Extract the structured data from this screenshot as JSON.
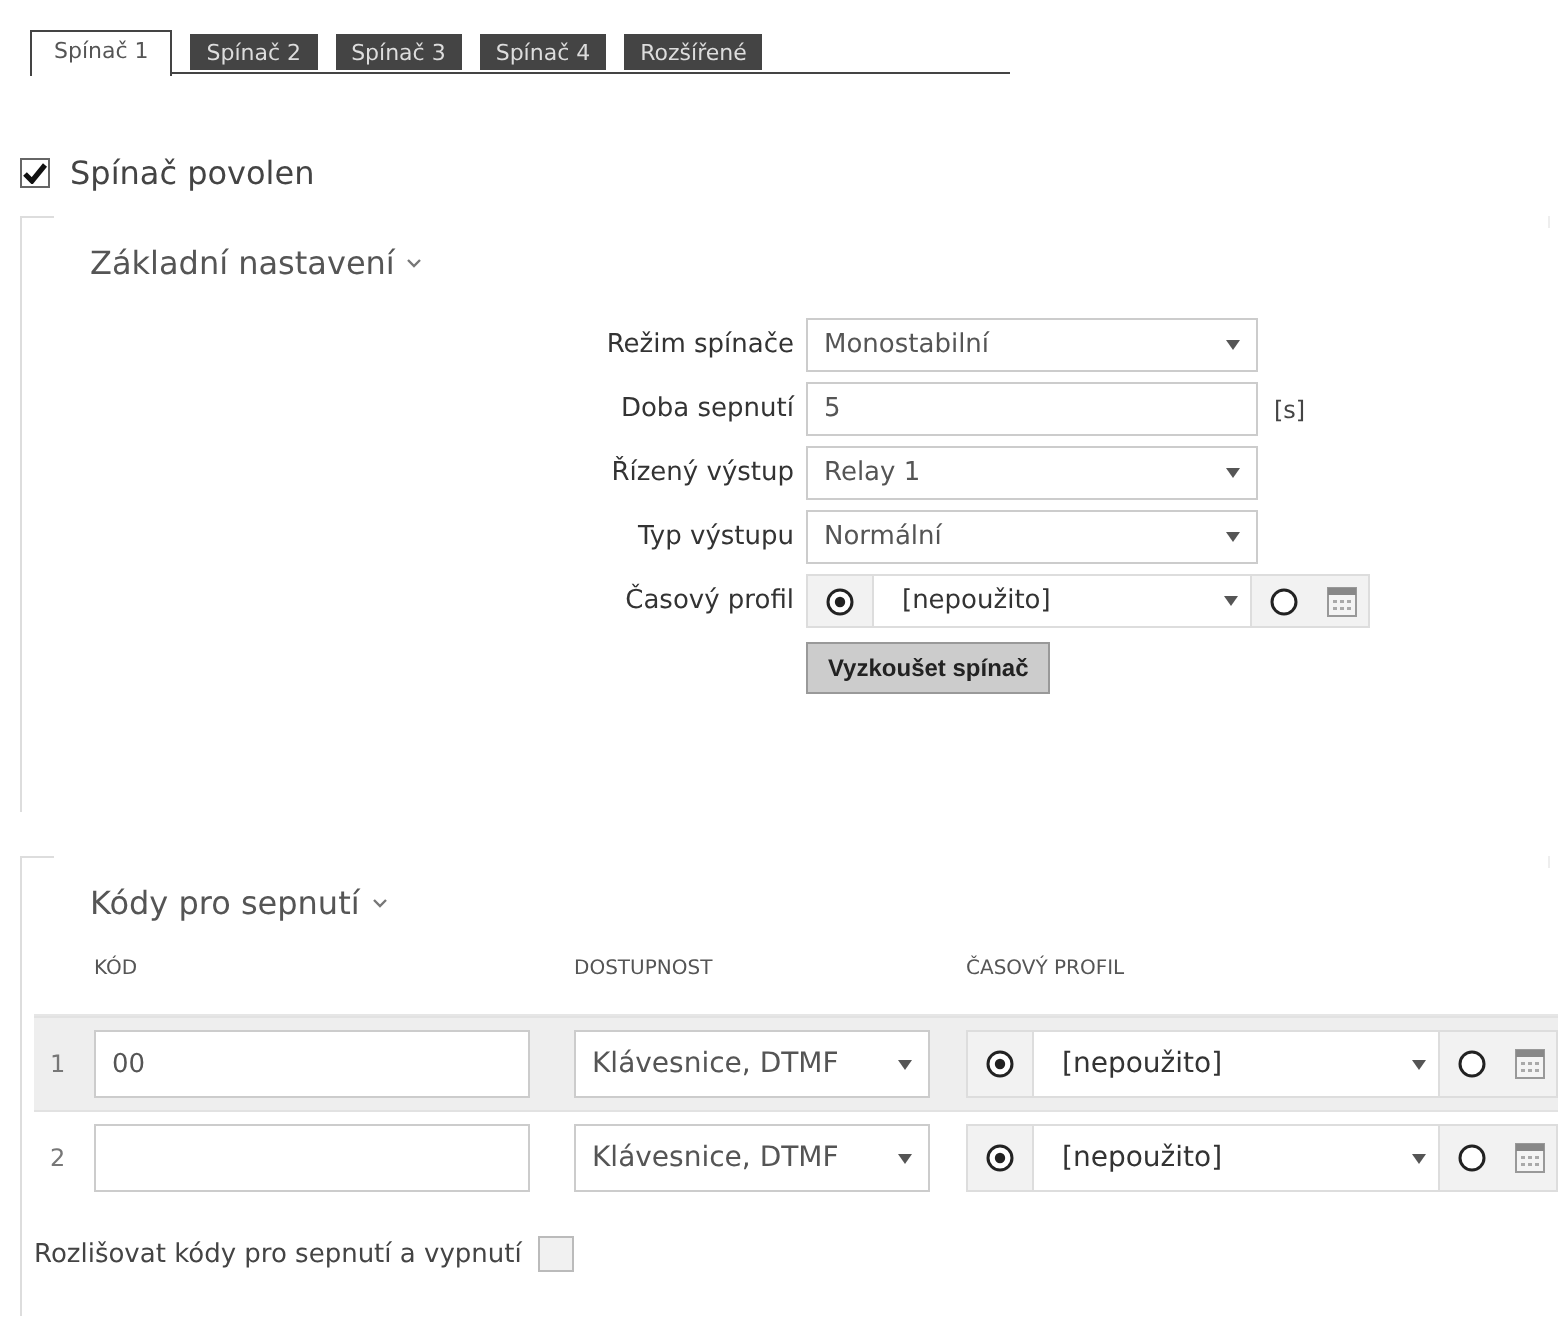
{
  "tabs": [
    {
      "label": "Spínač 1",
      "selected": true
    },
    {
      "label": "Spínač 2",
      "selected": false
    },
    {
      "label": "Spínač 3",
      "selected": false
    },
    {
      "label": "Spínač 4",
      "selected": false
    },
    {
      "label": "Rozšířené",
      "selected": false
    }
  ],
  "enabled": {
    "label": "Spínač povolen",
    "checked": true
  },
  "basic": {
    "title": "Základní nastavení",
    "expanded": true,
    "fields": [
      {
        "kind": "select",
        "label": "Režim spínače",
        "value": "Monostabilní"
      },
      {
        "kind": "text",
        "label": "Doba sepnutí",
        "value": "5",
        "unit": "[s]"
      },
      {
        "kind": "select",
        "label": "Řízený výstup",
        "value": "Relay 1"
      },
      {
        "kind": "select",
        "label": "Typ výstupu",
        "value": "Normální"
      },
      {
        "kind": "profile",
        "label": "Časový profil",
        "value": "[nepoužito]",
        "use_profile": true
      }
    ],
    "button": "Vyzkoušet spínač"
  },
  "codes": {
    "title": "Kódy pro sepnutí",
    "expanded": true,
    "columns": [
      "KÓD",
      "DOSTUPNOST",
      "ČASOVÝ PROFIL"
    ],
    "rows": [
      {
        "index": "1",
        "code": "00",
        "availability": "Klávesnice, DTMF",
        "profile": "[nepoužito]",
        "use_profile": true,
        "highlighted": true
      },
      {
        "index": "2",
        "availability": "Klávesnice, DTMF",
        "profile": "[nepoužito]",
        "use_profile": true,
        "highlighted": false
      }
    ]
  },
  "distinguish": {
    "label": "Rozlišovat kódy pro sepnutí a vypnutí",
    "checked": false
  }
}
